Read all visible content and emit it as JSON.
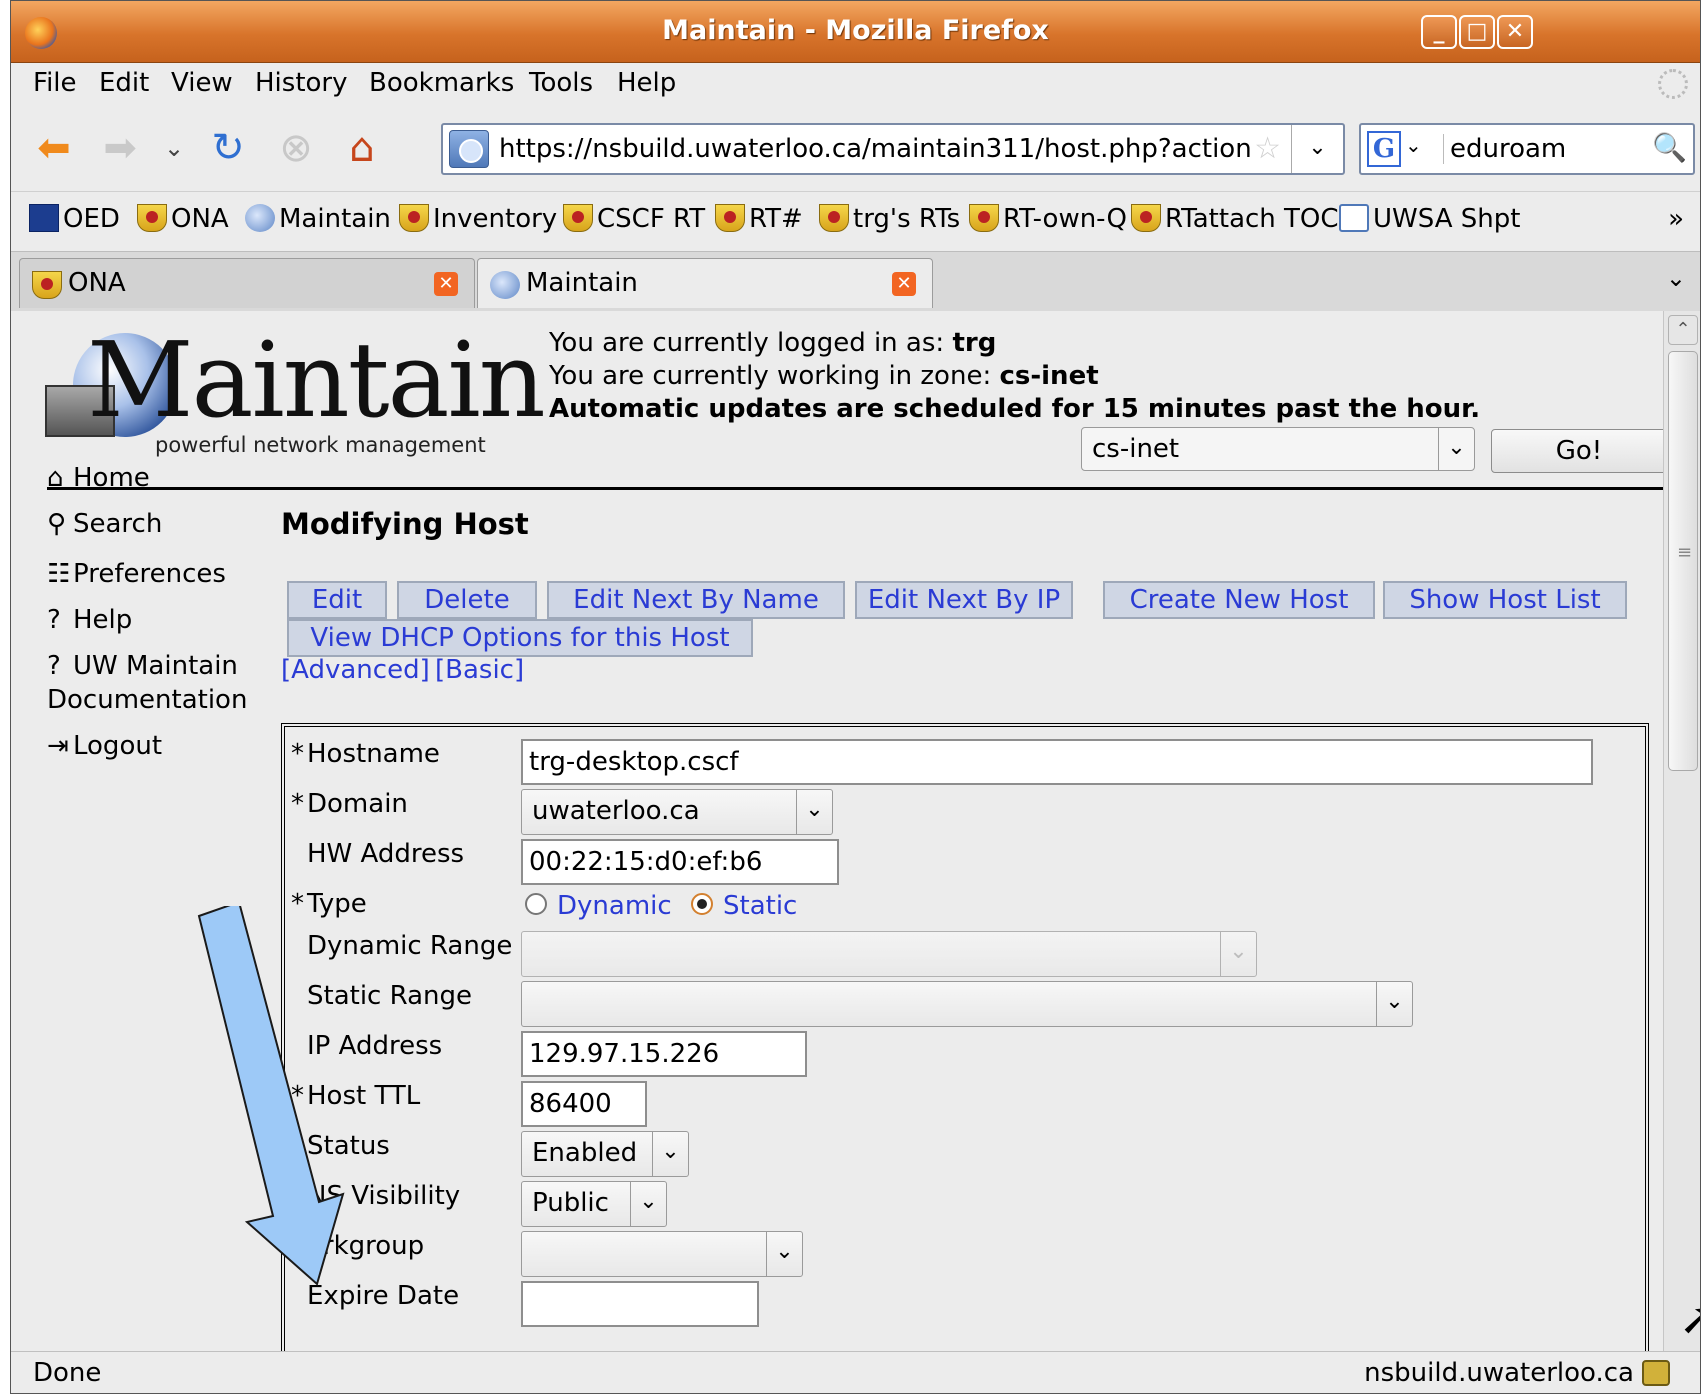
{
  "window": {
    "title": "Maintain - Mozilla Firefox"
  },
  "menu": [
    "File",
    "Edit",
    "View",
    "History",
    "Bookmarks",
    "Tools",
    "Help"
  ],
  "address": {
    "url": "https://nsbuild.uwaterloo.ca/maintain311/host.php?action"
  },
  "search": {
    "engine": "G",
    "query": "eduroam"
  },
  "bookmarks": [
    "OED",
    "ONA",
    "Maintain",
    "Inventory",
    "CSCF RT",
    "RT#",
    "trg's RTs",
    "RT-own-Q",
    "RTattach TOC",
    "UWSA Shpt"
  ],
  "bookmarks_more": "»",
  "tabs": [
    {
      "label": "ONA",
      "active": false
    },
    {
      "label": "Maintain",
      "active": true
    }
  ],
  "header": {
    "logo_word": "Maintain",
    "logo_tagline": "powerful network management",
    "logged_in_prefix": "You are currently logged in as: ",
    "logged_in_user": "trg",
    "zone_prefix": "You are currently working in zone: ",
    "zone_name": "cs-inet",
    "auto_updates": "Automatic updates are scheduled for 15 minutes past the hour.",
    "zone_select_value": "cs-inet",
    "go_label": "Go!"
  },
  "sidenav": {
    "home": "Home",
    "search": "Search",
    "preferences": "Preferences",
    "help": "Help",
    "uw_docs_line1": "UW Maintain",
    "uw_docs_line2": "Documentation",
    "logout": "Logout"
  },
  "page": {
    "title": "Modifying Host",
    "actions": [
      "Edit",
      "Delete",
      "Edit Next By Name",
      "Edit Next By IP",
      "Create New Host",
      "Show Host List",
      "View DHCP Options for this Host"
    ],
    "view_advanced": "[Advanced]",
    "view_basic": "[Basic]"
  },
  "form": {
    "required_mark": "*",
    "hostname_label": "Hostname",
    "hostname_value": "trg-desktop.cscf",
    "domain_label": "Domain",
    "domain_value": "uwaterloo.ca",
    "hw_label": "HW Address",
    "hw_value": "00:22:15:d0:ef:b6",
    "type_label": "Type",
    "type_options": [
      "Dynamic",
      "Static"
    ],
    "type_selected": "Static",
    "dynamic_range_label": "Dynamic Range",
    "static_range_label": "Static Range",
    "ip_label": "IP Address",
    "ip_value": "129.97.15.226",
    "ttl_label": "Host TTL",
    "ttl_value": "86400",
    "status_label": "Status",
    "status_value": "Enabled",
    "dns_label": "NS Visibility",
    "dns_value": "Public",
    "workgroup_label": "orkgroup",
    "expire_label": "Expire Date",
    "expire_value": ""
  },
  "status": {
    "text": "Done",
    "host": "nsbuild.uwaterloo.ca"
  },
  "colors": {
    "link": "#2a3bd4",
    "titlebar": "#d8742b",
    "arrow": "#9dc9f7"
  }
}
